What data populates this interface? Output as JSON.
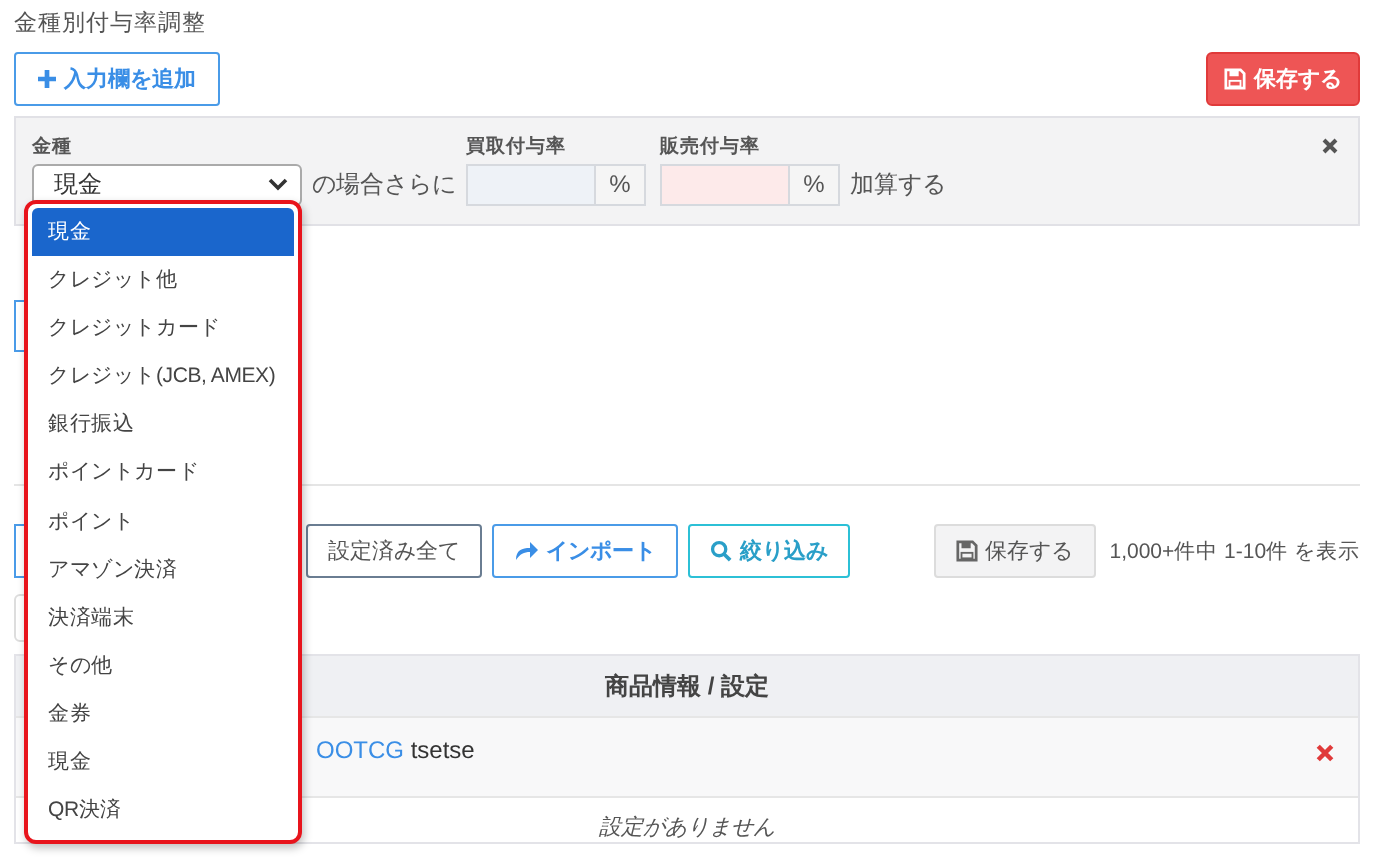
{
  "title": "金種別付与率調整",
  "add_button": "入力欄を追加",
  "save_button": "保存する",
  "rate_row": {
    "currency_label": "金種",
    "currency_value": "現金",
    "condition_text": "の場合さらに",
    "buy_label": "買取付与率",
    "buy_unit": "%",
    "sell_label": "販売付与率",
    "sell_unit": "%",
    "suffix": "加算する"
  },
  "dropdown": {
    "options": [
      {
        "label": "現金",
        "selected": true
      },
      {
        "label": "クレジット他",
        "selected": false
      },
      {
        "label": "クレジットカード",
        "selected": false
      },
      {
        "label": "クレジット(JCB, AMEX)",
        "selected": false
      },
      {
        "label": "銀行振込",
        "selected": false
      },
      {
        "label": "ポイントカード",
        "selected": false
      },
      {
        "label": "ポイント",
        "selected": false
      },
      {
        "label": "アマゾン決済",
        "selected": false
      },
      {
        "label": "決済端末",
        "selected": false
      },
      {
        "label": "その他",
        "selected": false
      },
      {
        "label": "金券",
        "selected": false
      },
      {
        "label": "現金",
        "selected": false
      },
      {
        "label": "QR決済",
        "selected": false
      }
    ]
  },
  "toolbar": {
    "buttons": [
      {
        "label": "設定済み全て",
        "kind": "plain"
      },
      {
        "label": "インポート",
        "kind": "import"
      },
      {
        "label": "絞り込み",
        "kind": "filter"
      }
    ],
    "save_button": "保存する",
    "count_text": "1,000+件中 1-10件 を表示"
  },
  "table": {
    "header": "商品情報 / 設定",
    "rows": [
      {
        "link": "OOTCG",
        "text": "tsetse"
      }
    ],
    "empty_text": "設定がありません"
  }
}
